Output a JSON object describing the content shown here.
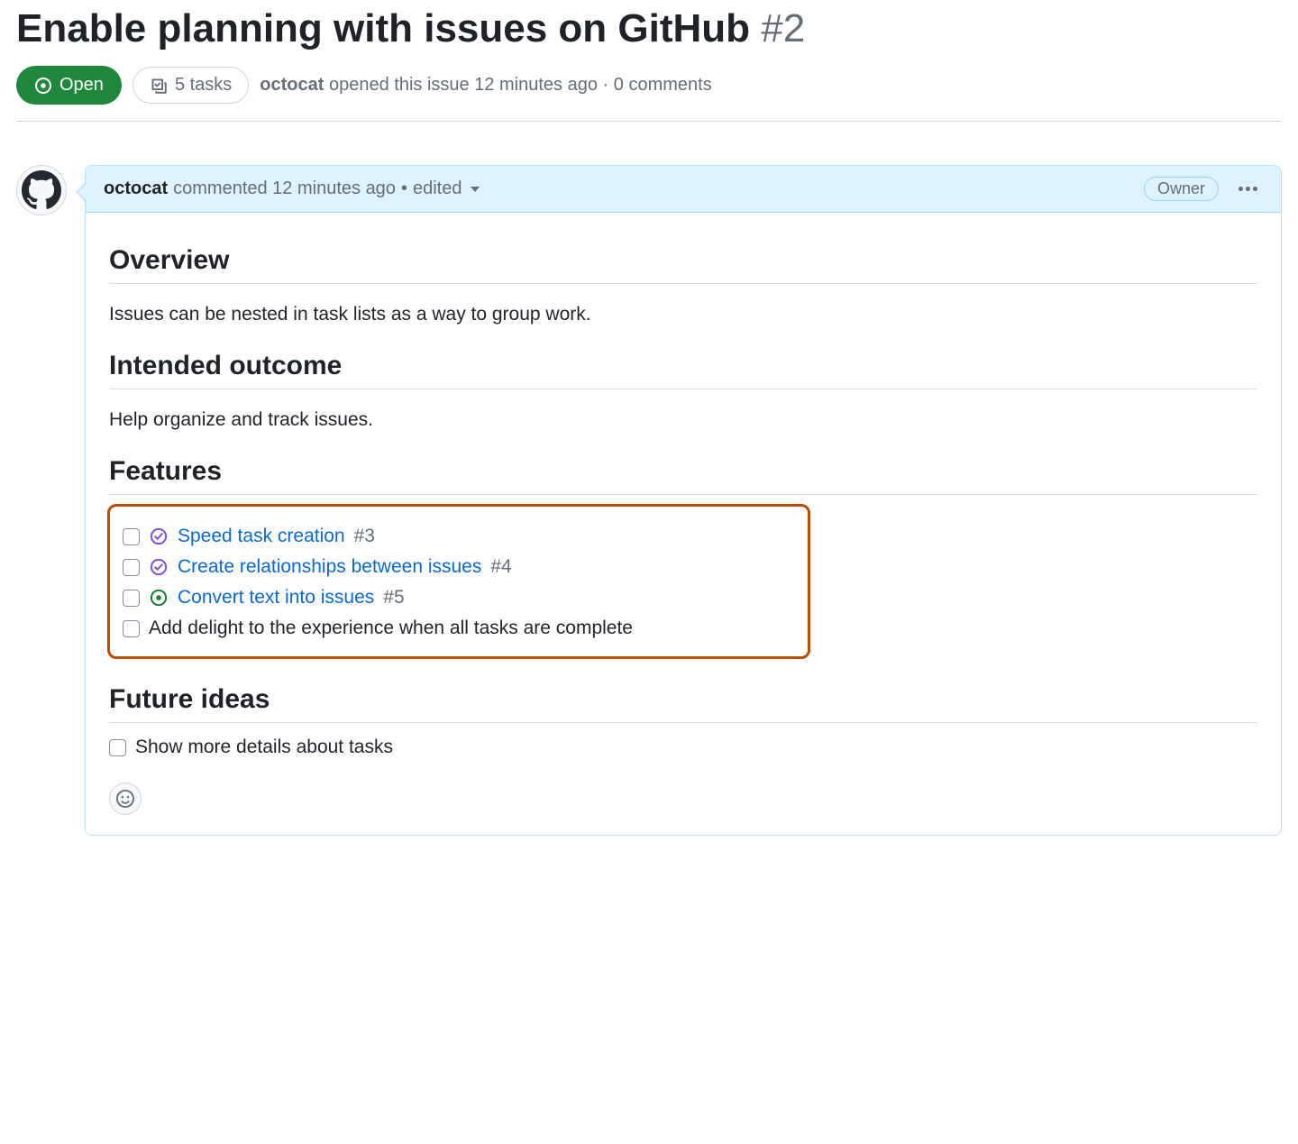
{
  "issue": {
    "title": "Enable planning with issues on GitHub",
    "number": "#2"
  },
  "meta": {
    "state": "Open",
    "tasks": "5 tasks",
    "author": "octocat",
    "opened_text": "opened this issue 12 minutes ago",
    "separator": "·",
    "comments": "0 comments"
  },
  "comment": {
    "author": "octocat",
    "commented_text": "commented 12 minutes ago",
    "edited_sep": "•",
    "edited": "edited",
    "owner_badge": "Owner"
  },
  "body": {
    "h_overview": "Overview",
    "p_overview": "Issues can be nested in task lists as a way to group work.",
    "h_outcome": "Intended outcome",
    "p_outcome": "Help organize and track issues.",
    "h_features": "Features",
    "features": [
      {
        "status": "closed",
        "link": "Speed task creation",
        "ref": "#3"
      },
      {
        "status": "closed",
        "link": "Create relationships between issues",
        "ref": "#4"
      },
      {
        "status": "open",
        "link": "Convert text into issues",
        "ref": "#5"
      },
      {
        "status": "text",
        "text": "Add delight to the experience when all tasks are complete"
      }
    ],
    "h_future": "Future ideas",
    "future": [
      {
        "text": "Show more details about tasks"
      }
    ]
  }
}
